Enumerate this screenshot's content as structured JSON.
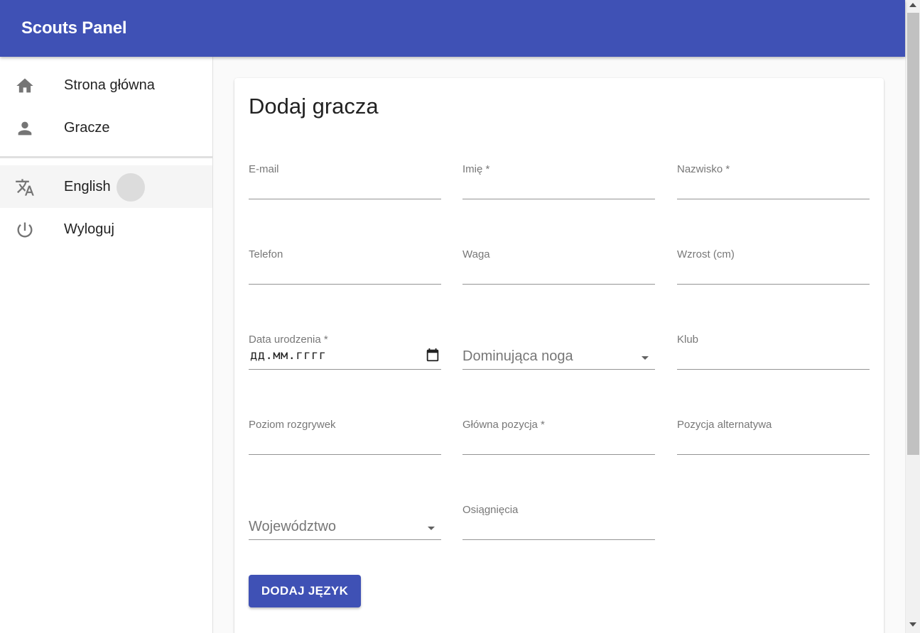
{
  "app": {
    "title": "Scouts Panel"
  },
  "sidebar": {
    "items": [
      {
        "label": "Strona główna",
        "icon": "home-icon"
      },
      {
        "label": "Gracze",
        "icon": "person-icon"
      },
      {
        "label": "English",
        "icon": "translate-icon"
      },
      {
        "label": "Wyloguj",
        "icon": "power-icon"
      }
    ]
  },
  "form": {
    "title": "Dodaj gracza",
    "email": {
      "label": "E-mail",
      "value": ""
    },
    "first_name": {
      "label": "Imię *",
      "value": ""
    },
    "last_name": {
      "label": "Nazwisko *",
      "value": ""
    },
    "phone": {
      "label": "Telefon",
      "value": ""
    },
    "weight": {
      "label": "Waga",
      "value": ""
    },
    "height": {
      "label": "Wzrost (cm)",
      "value": ""
    },
    "birth_date": {
      "label": "Data urodzenia *",
      "value": "дд.мм.гггг"
    },
    "dominant_foot": {
      "label": "Dominująca noga"
    },
    "club": {
      "label": "Klub",
      "value": ""
    },
    "league_level": {
      "label": "Poziom rozgrywek",
      "value": ""
    },
    "main_position": {
      "label": "Główna pozycja *",
      "value": ""
    },
    "alt_position": {
      "label": "Pozycja alternatywa",
      "value": ""
    },
    "voivodeship": {
      "label": "Województwo"
    },
    "achievements": {
      "label": "Osiągnięcia",
      "value": ""
    },
    "add_language_button": "DODAJ JĘZYK"
  },
  "colors": {
    "primary": "#3f51b5",
    "background": "#fafafa"
  }
}
